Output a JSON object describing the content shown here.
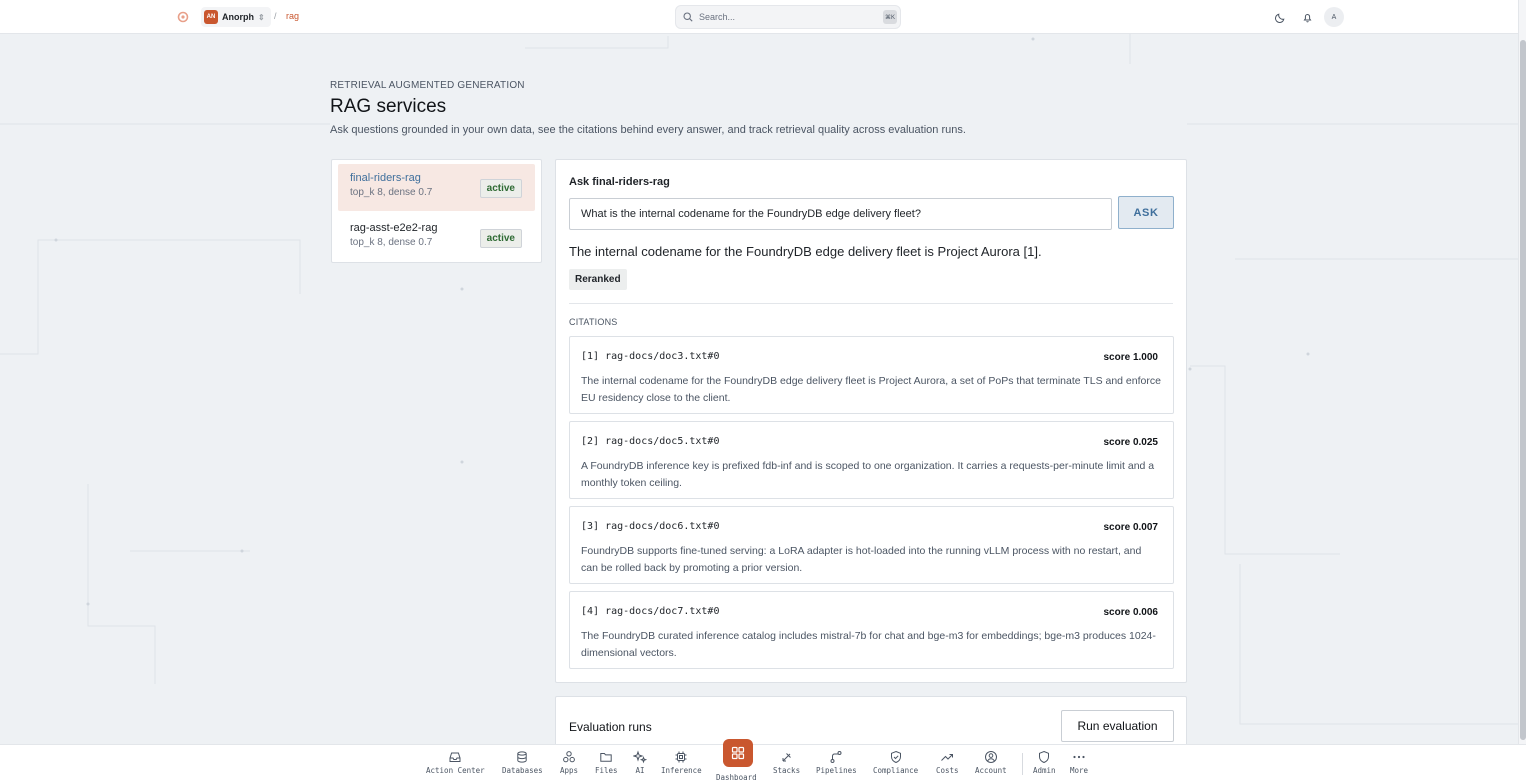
{
  "topbar": {
    "org_initials": "AN",
    "org_name": "Anorph",
    "crumb_separator": "/",
    "crumb_current": "rag",
    "search_placeholder": "Search...",
    "search_shortcut": "⌘K",
    "user_initial": "A"
  },
  "header": {
    "eyebrow": "RETRIEVAL AUGMENTED GENERATION",
    "title": "RAG services",
    "description": "Ask questions grounded in your own data, see the citations behind every answer, and track retrieval quality across evaluation runs."
  },
  "services": [
    {
      "name": "final-riders-rag",
      "meta": "top_k 8, dense 0.7",
      "status": "active",
      "selected": true
    },
    {
      "name": "rag-asst-e2e2-rag",
      "meta": "top_k 8, dense 0.7",
      "status": "active",
      "selected": false
    }
  ],
  "ask": {
    "title": "Ask final-riders-rag",
    "question": "What is the internal codename for the FoundryDB edge delivery fleet?",
    "button_label": "ASK",
    "answer": "The internal codename for the FoundryDB edge delivery fleet is Project Aurora [1].",
    "tag": "Reranked",
    "citations_heading": "CITATIONS"
  },
  "citations": [
    {
      "id": "[1] rag-docs/doc3.txt#0",
      "score": "score 1.000",
      "text": "The internal codename for the FoundryDB edge delivery fleet is Project Aurora, a set of PoPs that terminate TLS and enforce EU residency close to the client."
    },
    {
      "id": "[2] rag-docs/doc5.txt#0",
      "score": "score 0.025",
      "text": "A FoundryDB inference key is prefixed fdb-inf and is scoped to one organization. It carries a requests-per-minute limit and a monthly token ceiling."
    },
    {
      "id": "[3] rag-docs/doc6.txt#0",
      "score": "score 0.007",
      "text": "FoundryDB supports fine-tuned serving: a LoRA adapter is hot-loaded into the running vLLM process with no restart, and can be rolled back by promoting a prior version."
    },
    {
      "id": "[4] rag-docs/doc7.txt#0",
      "score": "score 0.006",
      "text": "The FoundryDB curated inference catalog includes mistral-7b for chat and bge-m3 for embeddings; bge-m3 produces 1024-dimensional vectors."
    }
  ],
  "evaluation": {
    "title": "Evaluation runs",
    "button_label": "Run evaluation"
  },
  "dock": {
    "items": [
      {
        "label": "Action Center",
        "icon": "inbox-icon"
      },
      {
        "label": "Databases",
        "icon": "database-icon"
      },
      {
        "label": "Apps",
        "icon": "apps-icon"
      },
      {
        "label": "Files",
        "icon": "folder-icon"
      },
      {
        "label": "AI",
        "icon": "sparkle-icon"
      },
      {
        "label": "Inference",
        "icon": "chip-icon"
      },
      {
        "label": "Dashboard",
        "icon": "grid-icon",
        "active": true
      },
      {
        "label": "Stacks",
        "icon": "stacks-icon"
      },
      {
        "label": "Pipelines",
        "icon": "pipeline-icon"
      },
      {
        "label": "Compliance",
        "icon": "shield-icon"
      },
      {
        "label": "Costs",
        "icon": "trend-icon"
      },
      {
        "label": "Account",
        "icon": "user-circle-icon"
      },
      {
        "label": "Admin",
        "icon": "shield-check-icon"
      },
      {
        "label": "More",
        "icon": "more-icon"
      }
    ]
  },
  "colors": {
    "accent": "#c9572f",
    "link": "#3f6f9c",
    "active_badge": "#2f6b34"
  }
}
